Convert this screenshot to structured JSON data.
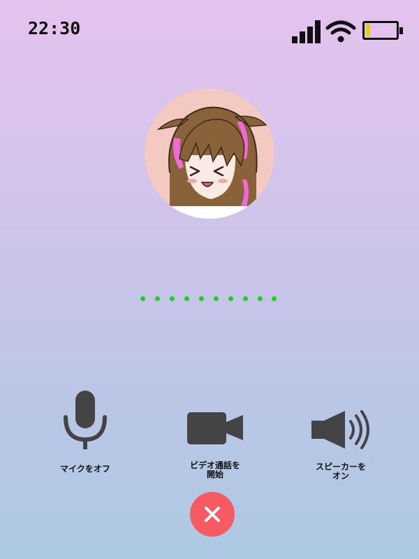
{
  "status_bar": {
    "time": "22:30",
    "icons": [
      "signal-icon",
      "wifi-icon",
      "battery-icon"
    ],
    "battery_level": 0.15,
    "battery_color": "#e6cf12"
  },
  "call": {
    "avatar_icon": "anime-character-avatar",
    "connecting_indicator_color": "#1fd11f"
  },
  "controls": {
    "mute": {
      "label": "マイクをオフ",
      "icon": "microphone-icon"
    },
    "video": {
      "label_line1": "ビデオ通話を",
      "label_line2": "開始",
      "icon": "video-camera-icon"
    },
    "speaker": {
      "label_line1": "スピーカーを",
      "label_line2": "オン",
      "icon": "speaker-icon"
    },
    "hangup": {
      "icon": "close-icon",
      "color": "#f65a62"
    }
  },
  "colors": {
    "background_top": "#e5c3ee",
    "background_bottom": "#aec9e4",
    "icon": "#444444"
  }
}
